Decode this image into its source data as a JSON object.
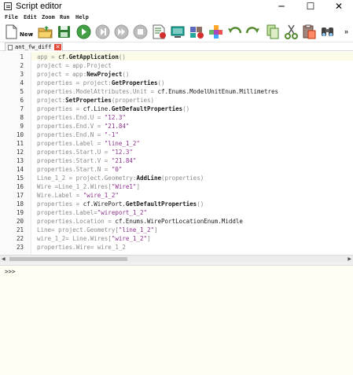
{
  "window": {
    "title": "Script editor",
    "minimize_glyph": "─",
    "maximize_glyph": "☐",
    "close_glyph": "✕"
  },
  "menu": [
    "File",
    "Edit",
    "Zoom",
    "Run",
    "Help"
  ],
  "toolbar": {
    "new_label": "New",
    "buttons": [
      "new-file-icon",
      "open-folder-icon",
      "save-icon",
      "run-icon",
      "step-icon",
      "fast-forward-icon",
      "stop-icon",
      "record-macro-icon",
      "screen-capture-icon",
      "settings-blocks-icon",
      "component-icon",
      "undo-icon",
      "redo-icon",
      "copy-icon",
      "cut-icon",
      "paste-icon",
      "find-icon"
    ],
    "overflow": "»"
  },
  "tab": {
    "label": "ant_fw_diff",
    "close": "✕"
  },
  "editor": {
    "lines": [
      {
        "n": "1",
        "text": "app = cf.GetApplication()"
      },
      {
        "n": "2",
        "text": "project = app.Project"
      },
      {
        "n": "3",
        "text": "project = app:NewProject()"
      },
      {
        "n": "4",
        "text": "properties = project:GetProperties()"
      },
      {
        "n": "5",
        "text": "properties.ModelAttributes.Unit = cf.Enums.ModelUnitEnum.Millimetres"
      },
      {
        "n": "6",
        "text": "project:SetProperties(properties)"
      },
      {
        "n": "7",
        "text": "properties = cf.Line.GetDefaultProperties()"
      },
      {
        "n": "8",
        "text": "properties.End.U = \"12.3\""
      },
      {
        "n": "9",
        "text": "properties.End.V = \"21.84\""
      },
      {
        "n": "10",
        "text": "properties.End.N = \"-1\""
      },
      {
        "n": "11",
        "text": "properties.Label = \"line_1_2\""
      },
      {
        "n": "12",
        "text": "properties.Start.U = \"12.3\""
      },
      {
        "n": "13",
        "text": "properties.Start.V = \"21.84\""
      },
      {
        "n": "14",
        "text": "properties.Start.N = \"0\""
      },
      {
        "n": "15",
        "text": "Line_1_2 = project.Geometry:AddLine(properties)"
      },
      {
        "n": "16",
        "text": "Wire =Line_1_2.Wires[\"Wire1\"]"
      },
      {
        "n": "17",
        "text": "Wire.Label = \"wire_1_2\""
      },
      {
        "n": "18",
        "text": "properties = cf.WirePort.GetDefaultProperties()"
      },
      {
        "n": "19",
        "text": "properties.Label=\"wireport_1_2\""
      },
      {
        "n": "20",
        "text": "properties.Location = cf.Enums.WirePortLocationEnum.Middle"
      },
      {
        "n": "21",
        "text": "Line= project.Geometry[\"line_1_2\"]"
      },
      {
        "n": "22",
        "text": "wire_1_2= Line.Wires[\"wire_1_2\"]"
      },
      {
        "n": "23",
        "text": "properties.Wire= wire_1_2"
      }
    ]
  },
  "scrollbar": {
    "left_arrow": "◀",
    "right_arrow": "▶"
  },
  "console": {
    "prompt": ">>>"
  },
  "colors": {
    "string": "#8b2f8b",
    "code_default": "#8a8a8a",
    "console_bg": "#fefef3",
    "current_line": "#fbfbe8"
  }
}
